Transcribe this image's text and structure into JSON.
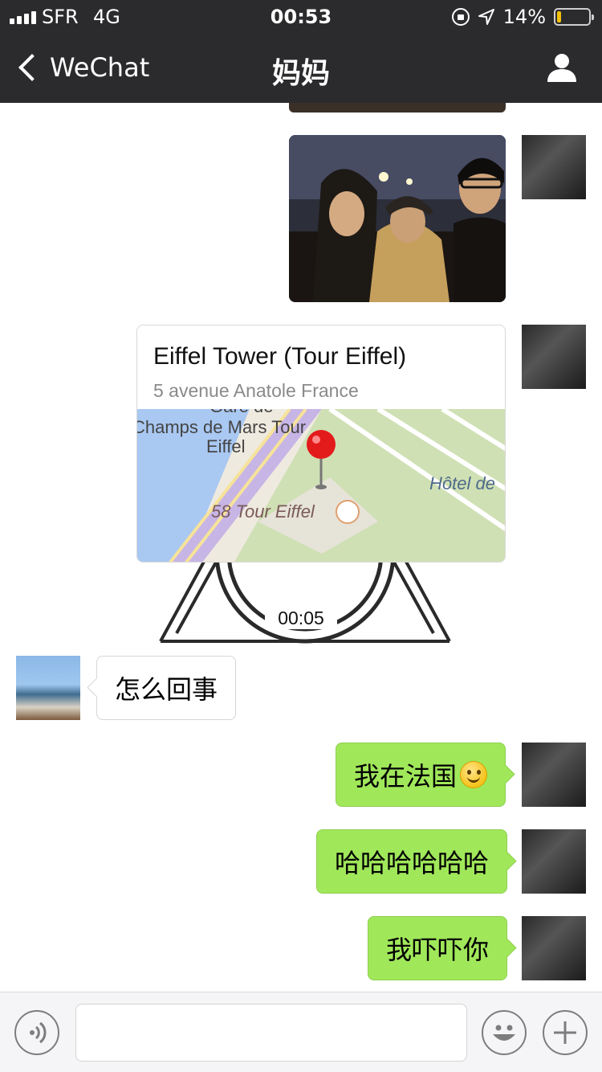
{
  "status_bar": {
    "carrier": "SFR",
    "network": "4G",
    "time": "00:53",
    "battery": "14%",
    "battery_level": 0.14
  },
  "nav": {
    "back_label": "WeChat",
    "title": "妈妈"
  },
  "messages": {
    "location": {
      "name": "Eiffel Tower (Tour Eiffel)",
      "address": "5 avenue Anatole France",
      "map_labels": [
        "Gare de",
        "Champs de Mars Tour",
        "Eiffel",
        "58 Tour Eiffel",
        "Hôtel de"
      ]
    },
    "voice_duration": "00:05",
    "mom_text": "怎么回事",
    "me_1": "我在法国",
    "me_2": "哈哈哈哈哈哈",
    "me_3": "我吓吓你"
  },
  "colors": {
    "nav_bg": "#2b2b2d",
    "outgoing_bubble": "#a0e75a",
    "map_pin": "#e31b1b"
  }
}
